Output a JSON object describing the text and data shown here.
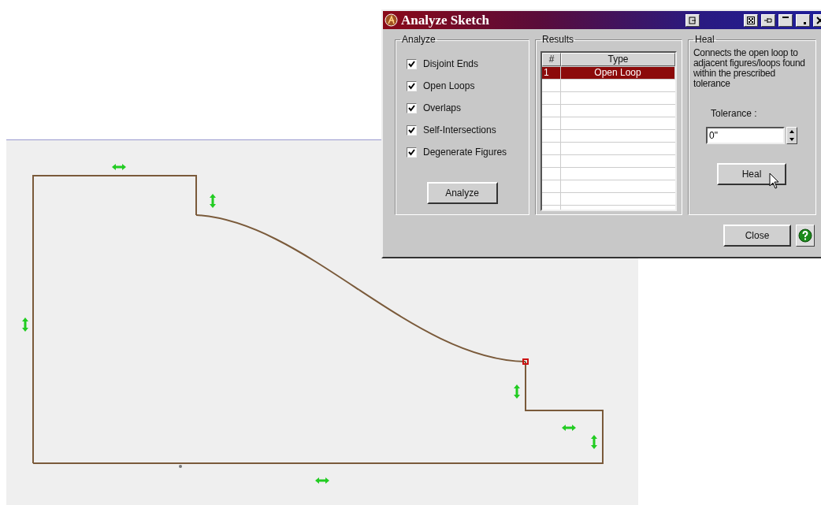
{
  "window": {
    "title": "Analyze Sketch"
  },
  "analyze": {
    "title": "Analyze",
    "options": [
      {
        "label": "Disjoint Ends",
        "checked": true
      },
      {
        "label": "Open Loops",
        "checked": true
      },
      {
        "label": "Overlaps",
        "checked": true
      },
      {
        "label": "Self-Intersections",
        "checked": true
      },
      {
        "label": "Degenerate Figures",
        "checked": true
      }
    ],
    "button": "Analyze"
  },
  "results": {
    "title": "Results",
    "columns": [
      "#",
      "Type"
    ],
    "rows": [
      {
        "cells": [
          "1",
          "Open Loop"
        ],
        "selected": true
      }
    ]
  },
  "heal": {
    "title": "Heal",
    "description": "Connects the open loop to adjacent figures/loops found within the prescribed tolerance",
    "tolerance_label": "Tolerance :",
    "tolerance_value": "0\"",
    "button": "Heal"
  },
  "footer": {
    "close": "Close"
  }
}
